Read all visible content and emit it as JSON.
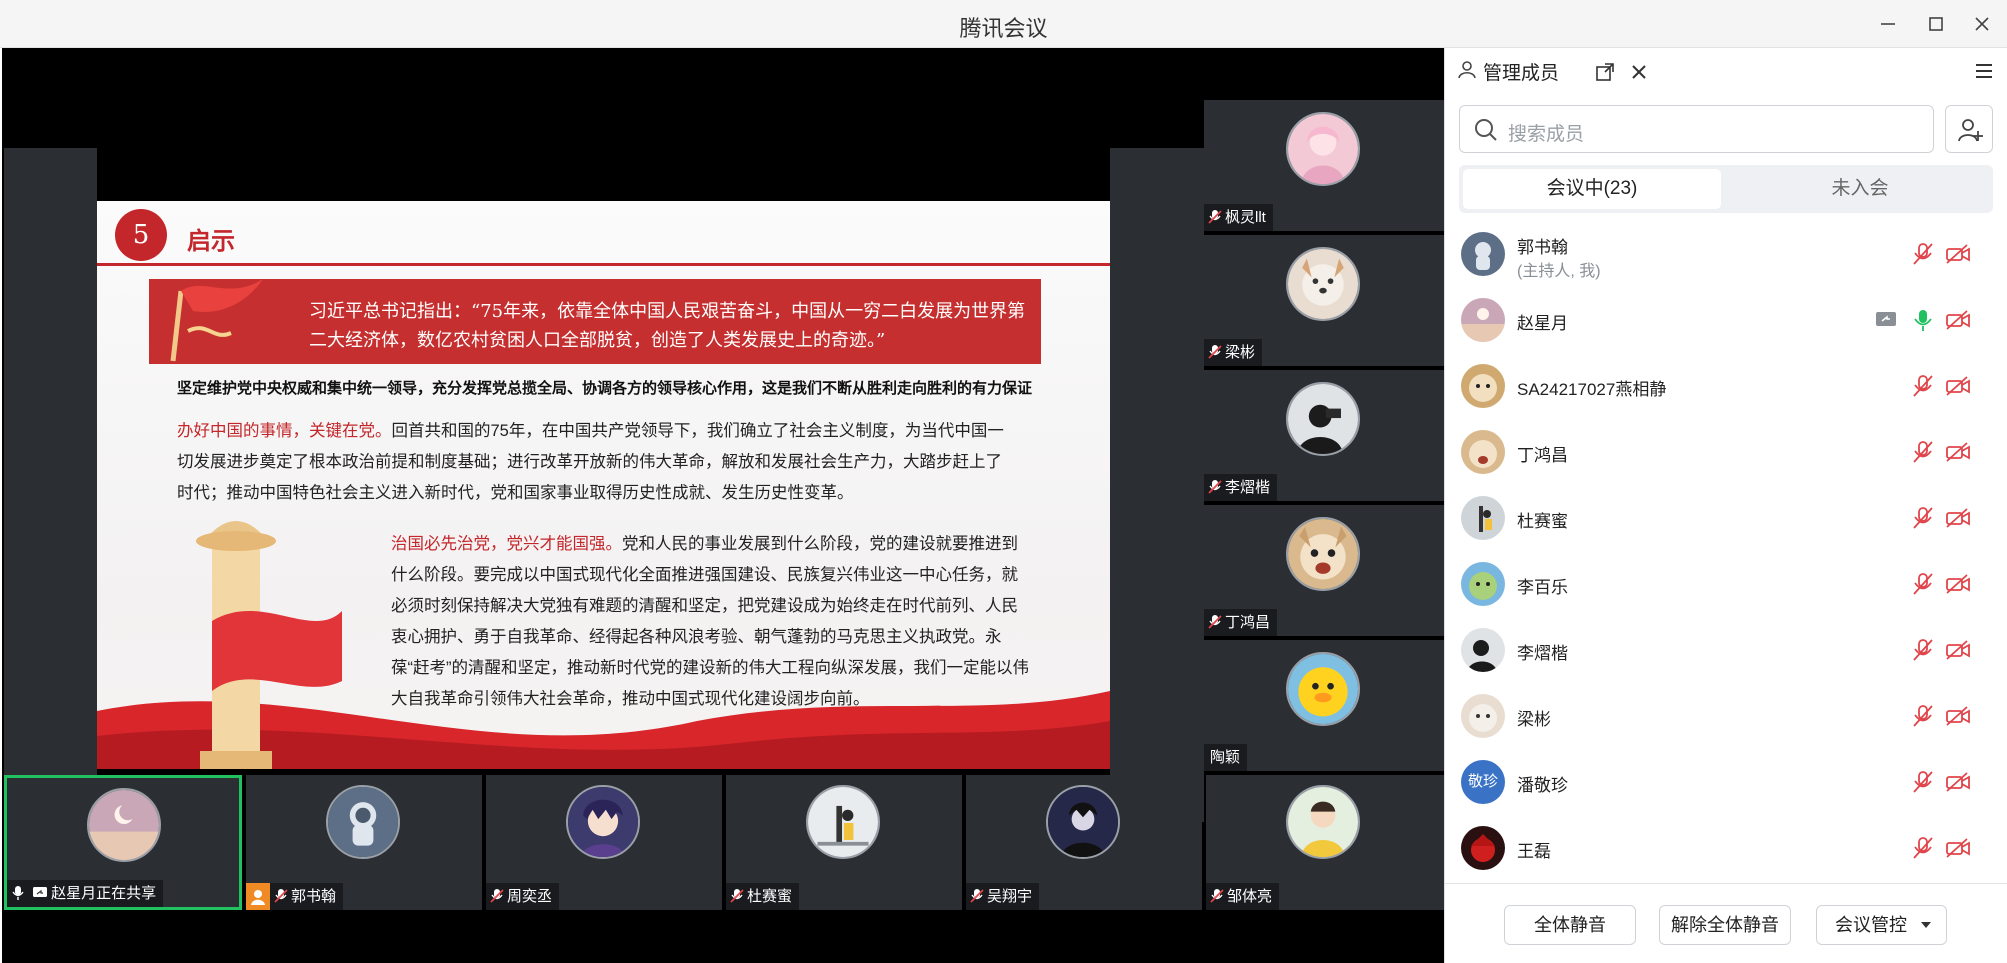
{
  "window": {
    "title": "腾讯会议"
  },
  "slide": {
    "number": "5",
    "heading": "启示",
    "quote": "习近平总书记指出：“75年来，依靠全体中国人民艰苦奋斗，中国从一穷二白发展为世界第二大经济体，数亿农村贫困人口全部脱贫，创造了人类发展史上的奇迹。”",
    "bold_line": "坚定维护党中央权威和集中统一领导，充分发挥党总揽全局、协调各方的领导核心作用，这是我们不断从胜利走向胜利的有力保证",
    "para1_highlight": "办好中国的事情，关键在党。",
    "para1_text": "回首共和国的75年，在中国共产党领导下，我们确立了社会主义制度，为当代中国一切发展进步奠定了根本政治前提和制度基础；进行改革开放新的伟大革命，解放和发展社会生产力，大踏步赶上了时代；推动中国特色社会主义进入新时代，党和国家事业取得历史性成就、发生历史性变革。",
    "para2_highlight": "治国必先治党，党兴才能国强。",
    "para2_text": "党和人民的事业发展到什么阶段，党的建设就要推进到什么阶段。要完成以中国式现代化全面推进强国建设、民族复兴伟业这一中心任务，就必须时刻保持解决大党独有难题的清醒和坚定，把党建设成为始终走在时代前列、人民衷心拥护、勇于自我革命、经得起各种风浪考验、朝气蓬勃的马克思主义执政党。永葆“赶考”的清醒和坚定，推动新时代党的建设新的伟大工程向纵深发展，我们一定能以伟大自我革命引领伟大社会革命，推动中国式现代化建设阔步向前。"
  },
  "side_tiles": [
    {
      "name": "枫灵llt"
    },
    {
      "name": "梁彬"
    },
    {
      "name": "李熠楷"
    },
    {
      "name": "丁鸿昌"
    },
    {
      "name": "陶颖"
    }
  ],
  "bottom_tiles": [
    {
      "name": "赵星月正在共享"
    },
    {
      "name": "郭书翰"
    },
    {
      "name": "周奕丞"
    },
    {
      "name": "杜赛蜜"
    },
    {
      "name": "吴翔宇"
    },
    {
      "name": "邹体亮"
    }
  ],
  "panel": {
    "title": "管理成员",
    "search_placeholder": "搜索成员",
    "tab_in_meeting": "会议中(23)",
    "tab_not_joined": "未入会",
    "members": [
      {
        "name": "郭书翰",
        "sub": "(主持人, 我)"
      },
      {
        "name": "赵星月"
      },
      {
        "name": "SA24217027燕相静"
      },
      {
        "name": "丁鸿昌"
      },
      {
        "name": "杜赛蜜"
      },
      {
        "name": "李百乐"
      },
      {
        "name": "李熠楷"
      },
      {
        "name": "梁彬"
      },
      {
        "name": "潘敬珍",
        "avatar_text": "敬珍"
      },
      {
        "name": "王磊"
      }
    ],
    "mute_all": "全体静音",
    "unmute_all": "解除全体静音",
    "meeting_control": "会议管控"
  },
  "colors": {
    "accent_red": "#c4272b",
    "active_green": "#21c061",
    "muted_red": "#e0454b",
    "unmuted_green": "#21c061"
  }
}
